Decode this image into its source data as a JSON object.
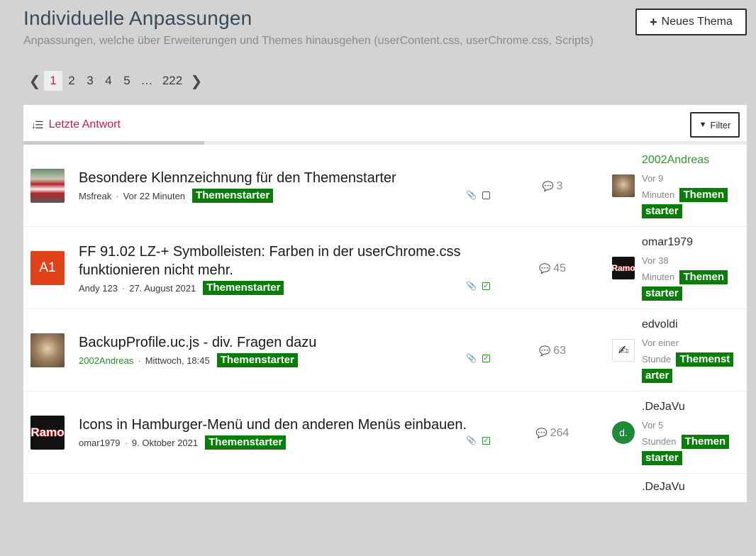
{
  "header": {
    "title": "Individuelle Anpassungen",
    "subtitle": "Anpassungen, welche über Erweiterungen und Themes hinausgehen (userContent.css, userChrome.css, Scripts)",
    "new_thread_label": "Neues Thema"
  },
  "pagination": {
    "pages": [
      "1",
      "2",
      "3",
      "4",
      "5"
    ],
    "ellipsis": "…",
    "last": "222",
    "current": "1"
  },
  "sortbar": {
    "sort_label": "Letzte Antwort",
    "filter_label": "Filter"
  },
  "colors": {
    "accent": "#d0145a",
    "badge": "#0a7d0a",
    "green_user": "#2a9a2a"
  },
  "threads": [
    {
      "title_line1": "Besondere Klennzeichnung für den Themenstarter",
      "title_line2": "",
      "author": "Msfreak",
      "time": "Vor 22 Minuten",
      "badge": "Themenstarter",
      "replies": "3",
      "last_user": "2002Andreas",
      "last_time_1": "Vor 9",
      "last_time_2": "Minuten",
      "last_badge_1": "Themen",
      "last_badge_2": "starter"
    },
    {
      "title_line1": "FF 91.02 LZ-+ Symbolleisten: Farben in der userChrome.css",
      "title_line2": "funktionieren nicht mehr.",
      "avatar_text": "A1",
      "author": "Andy 123",
      "time": "27. August 2021",
      "badge": "Themenstarter",
      "replies": "45",
      "last_user": "omar1979",
      "last_avatar_text": "Ramo",
      "last_time_1": "Vor 38",
      "last_time_2": "Minuten",
      "last_badge_1": "Themen",
      "last_badge_2": "starter"
    },
    {
      "title_line1": "BackupProfile.uc.js - div. Fragen dazu",
      "title_line2": "",
      "author": "2002Andreas",
      "time": "Mittwoch, 18:45",
      "badge": "Themenstarter",
      "replies": "63",
      "last_user": "edvoldi",
      "last_time_1": "Vor einer",
      "last_time_2": "Stunde",
      "last_badge_1": "Themenst",
      "last_badge_2": "arter"
    },
    {
      "title_line1": "Icons in Hamburger-Menü und den anderen Menüs einbauen.",
      "title_line2": "",
      "avatar_text": "Ramo",
      "author": "omar1979",
      "time": "9. Oktober 2021",
      "badge": "Themenstarter",
      "replies": "264",
      "last_user": ".DeJaVu",
      "last_avatar_text": "d.",
      "last_time_1": "Vor 5",
      "last_time_2": "Stunden",
      "last_badge_1": "Themen",
      "last_badge_2": "starter"
    },
    {
      "last_user": ".DeJaVu"
    }
  ]
}
